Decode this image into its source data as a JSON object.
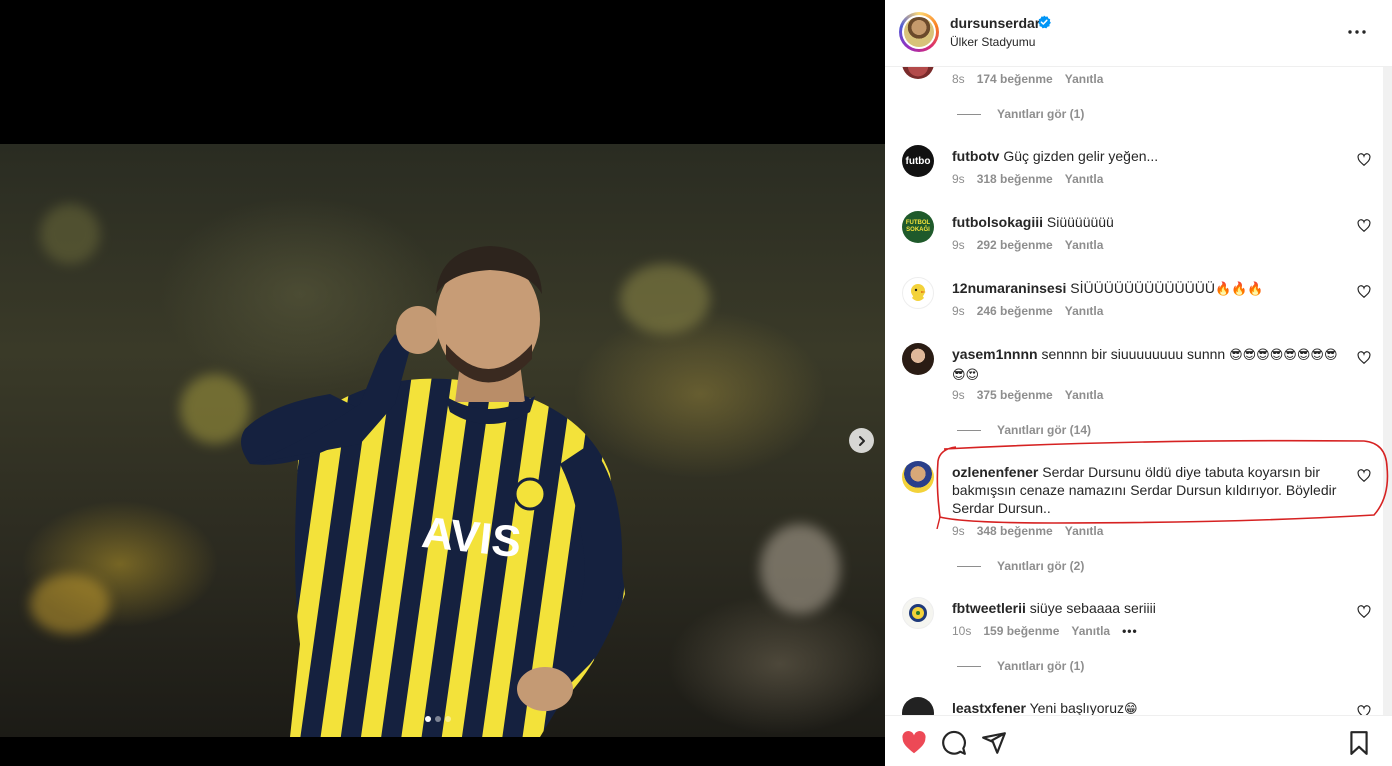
{
  "post": {
    "username": "dursunserdar",
    "location": "Ülker Stadyumu"
  },
  "colors": {
    "like_red": "#ed4956",
    "muted": "#8e8e8e",
    "text": "#262626",
    "annotation_red": "#d62222"
  },
  "comments": [
    {
      "id": "c0",
      "user": "",
      "text": "",
      "time": "8s",
      "likes": "174 beğenme",
      "reply": "Yanıtla",
      "view_replies": "Yanıtları gör (1)"
    },
    {
      "id": "c1",
      "user": "futbotv",
      "text": "Güç gizden gelir yeğen...",
      "time": "9s",
      "likes": "318 beğenme",
      "reply": "Yanıtla"
    },
    {
      "id": "c2",
      "user": "futbolsokagiii",
      "text": "Siüüüüüüü",
      "time": "9s",
      "likes": "292 beğenme",
      "reply": "Yanıtla"
    },
    {
      "id": "c3",
      "user": "12numaraninsesi",
      "text": "SİÜÜÜÜÜÜÜÜÜÜÜÜÜ",
      "emoji": "🔥🔥🔥",
      "time": "9s",
      "likes": "246 beğenme",
      "reply": "Yanıtla"
    },
    {
      "id": "c4",
      "user": "yasem1nnnn",
      "text": "sennnn bir siuuuuuuuu sunnn",
      "emoji": "😎😎😎😎😎😎😎😎😎😍",
      "time": "9s",
      "likes": "375 beğenme",
      "reply": "Yanıtla",
      "view_replies": "Yanıtları gör (14)"
    },
    {
      "id": "c5",
      "user": "ozlenenfener",
      "text": "Serdar Dursunu öldü diye tabuta koyarsın bir bakmışsın cenaze namazını Serdar Dursun kıldırıyor. Böyledir Serdar Dursun..",
      "time": "9s",
      "likes": "348 beğenme",
      "reply": "Yanıtla",
      "view_replies": "Yanıtları gör (2)"
    },
    {
      "id": "c6",
      "user": "fbtweetlerii",
      "text": "siüye sebaaaa seriiii",
      "time": "10s",
      "likes": "159 beğenme",
      "reply": "Yanıtla",
      "more": "•••",
      "view_replies": "Yanıtları gör (1)"
    },
    {
      "id": "c7",
      "user": "leastxfener",
      "text": "Yeni başlıyoruz",
      "emoji": "😁"
    }
  ],
  "avatars": {
    "futbotv_label": "futbo",
    "futbolsokagiii_label": "FUTBOL SOKAĞI"
  },
  "media": {
    "jersey_sponsor": "AVIS",
    "slide_count": 3,
    "active_slide": 1
  }
}
